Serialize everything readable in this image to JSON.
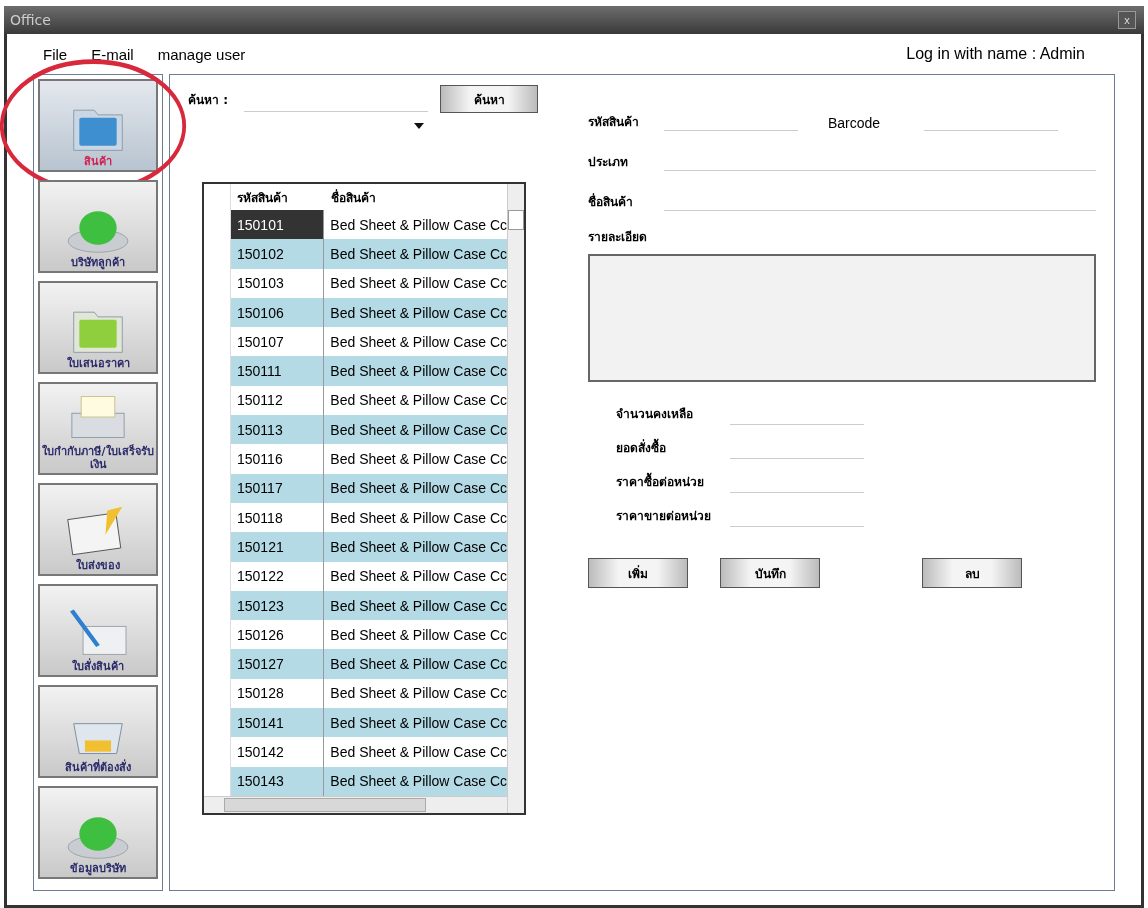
{
  "window": {
    "title": "Office",
    "close": "x"
  },
  "menu": [
    "File",
    "E-mail",
    "manage user"
  ],
  "login": "Log in with name : Admin",
  "sidebar": {
    "items": [
      {
        "label": "สินค้า",
        "selected": true,
        "circled": true
      },
      {
        "label": "บริษัทลูกค้า",
        "selected": false,
        "circled": false
      },
      {
        "label": "ใบเสนอราคา",
        "selected": false,
        "circled": false
      },
      {
        "label": "ใบกำกับภาษี/ใบเสร็จรับเงิน",
        "selected": false,
        "circled": false
      },
      {
        "label": "ใบส่งของ",
        "selected": false,
        "circled": false
      },
      {
        "label": "ใบสั่งสินค้า",
        "selected": false,
        "circled": false
      },
      {
        "label": "สินค้าที่ต้องสั่ง",
        "selected": false,
        "circled": false
      },
      {
        "label": "ข้อมูลบริษัท",
        "selected": false,
        "circled": false
      }
    ]
  },
  "search": {
    "label": "ค้นหา :",
    "button": "ค้นหา"
  },
  "table": {
    "columns": [
      "รหัสสินค้า",
      "ชื่อสินค้า"
    ],
    "rows": [
      {
        "code": "150101",
        "name": "Bed Sheet & Pillow Case Cc",
        "selected": true
      },
      {
        "code": "150102",
        "name": "Bed Sheet & Pillow Case Cc",
        "selected": false
      },
      {
        "code": "150103",
        "name": "Bed Sheet & Pillow Case Cc",
        "selected": false
      },
      {
        "code": "150106",
        "name": "Bed Sheet & Pillow Case Cc",
        "selected": false
      },
      {
        "code": "150107",
        "name": "Bed Sheet & Pillow Case Cc",
        "selected": false
      },
      {
        "code": "150111",
        "name": "Bed Sheet & Pillow Case Cc",
        "selected": false
      },
      {
        "code": "150112",
        "name": "Bed Sheet & Pillow Case Cc",
        "selected": false
      },
      {
        "code": "150113",
        "name": "Bed Sheet & Pillow Case Cc",
        "selected": false
      },
      {
        "code": "150116",
        "name": "Bed Sheet & Pillow Case Cc",
        "selected": false
      },
      {
        "code": "150117",
        "name": "Bed Sheet & Pillow Case Cc",
        "selected": false
      },
      {
        "code": "150118",
        "name": "Bed Sheet & Pillow Case Cc",
        "selected": false
      },
      {
        "code": "150121",
        "name": "Bed Sheet & Pillow Case Cc",
        "selected": false
      },
      {
        "code": "150122",
        "name": "Bed Sheet & Pillow Case Cc",
        "selected": false
      },
      {
        "code": "150123",
        "name": "Bed Sheet & Pillow Case Cc",
        "selected": false
      },
      {
        "code": "150126",
        "name": "Bed Sheet & Pillow Case Cc",
        "selected": false
      },
      {
        "code": "150127",
        "name": "Bed Sheet & Pillow Case Cc",
        "selected": false
      },
      {
        "code": "150128",
        "name": "Bed Sheet & Pillow Case Cc",
        "selected": false
      },
      {
        "code": "150141",
        "name": "Bed Sheet & Pillow Case Cc",
        "selected": false
      },
      {
        "code": "150142",
        "name": "Bed Sheet & Pillow Case Cc",
        "selected": false
      },
      {
        "code": "150143",
        "name": "Bed Sheet & Pillow Case Cc",
        "selected": false
      }
    ]
  },
  "form": {
    "code_label": "รหัสสินค้า",
    "barcode_label": "Barcode",
    "type_label": "ประเภท",
    "name_label": "ชื่อสินค้า",
    "detail_label": "รายละเอียด",
    "numbers": [
      "จำนวนคงเหลือ",
      "ยอดสั่งซื้อ",
      "ราคาซื้อต่อหน่วย",
      "ราคาขายต่อหน่วย"
    ],
    "buttons": [
      "เพิ่ม",
      "บันทึก",
      "ลบ"
    ]
  }
}
